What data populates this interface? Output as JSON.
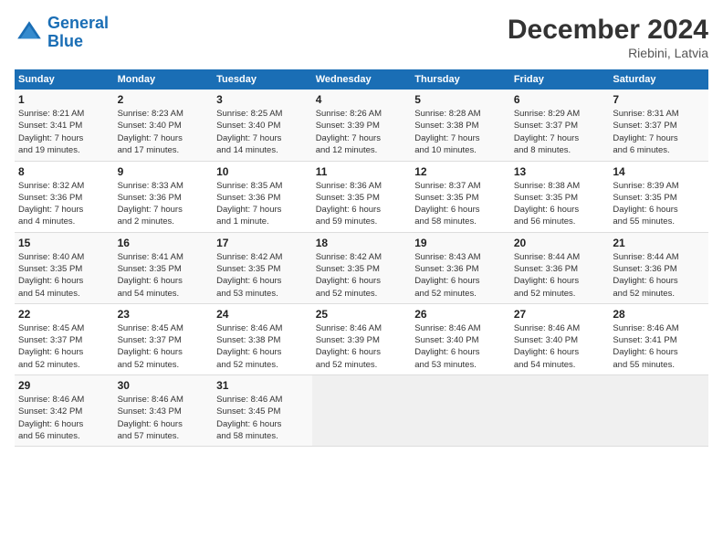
{
  "header": {
    "logo_line1": "General",
    "logo_line2": "Blue",
    "month": "December 2024",
    "location": "Riebini, Latvia"
  },
  "days_of_week": [
    "Sunday",
    "Monday",
    "Tuesday",
    "Wednesday",
    "Thursday",
    "Friday",
    "Saturday"
  ],
  "weeks": [
    [
      {
        "day": "1",
        "info": "Sunrise: 8:21 AM\nSunset: 3:41 PM\nDaylight: 7 hours\nand 19 minutes."
      },
      {
        "day": "2",
        "info": "Sunrise: 8:23 AM\nSunset: 3:40 PM\nDaylight: 7 hours\nand 17 minutes."
      },
      {
        "day": "3",
        "info": "Sunrise: 8:25 AM\nSunset: 3:40 PM\nDaylight: 7 hours\nand 14 minutes."
      },
      {
        "day": "4",
        "info": "Sunrise: 8:26 AM\nSunset: 3:39 PM\nDaylight: 7 hours\nand 12 minutes."
      },
      {
        "day": "5",
        "info": "Sunrise: 8:28 AM\nSunset: 3:38 PM\nDaylight: 7 hours\nand 10 minutes."
      },
      {
        "day": "6",
        "info": "Sunrise: 8:29 AM\nSunset: 3:37 PM\nDaylight: 7 hours\nand 8 minutes."
      },
      {
        "day": "7",
        "info": "Sunrise: 8:31 AM\nSunset: 3:37 PM\nDaylight: 7 hours\nand 6 minutes."
      }
    ],
    [
      {
        "day": "8",
        "info": "Sunrise: 8:32 AM\nSunset: 3:36 PM\nDaylight: 7 hours\nand 4 minutes."
      },
      {
        "day": "9",
        "info": "Sunrise: 8:33 AM\nSunset: 3:36 PM\nDaylight: 7 hours\nand 2 minutes."
      },
      {
        "day": "10",
        "info": "Sunrise: 8:35 AM\nSunset: 3:36 PM\nDaylight: 7 hours\nand 1 minute."
      },
      {
        "day": "11",
        "info": "Sunrise: 8:36 AM\nSunset: 3:35 PM\nDaylight: 6 hours\nand 59 minutes."
      },
      {
        "day": "12",
        "info": "Sunrise: 8:37 AM\nSunset: 3:35 PM\nDaylight: 6 hours\nand 58 minutes."
      },
      {
        "day": "13",
        "info": "Sunrise: 8:38 AM\nSunset: 3:35 PM\nDaylight: 6 hours\nand 56 minutes."
      },
      {
        "day": "14",
        "info": "Sunrise: 8:39 AM\nSunset: 3:35 PM\nDaylight: 6 hours\nand 55 minutes."
      }
    ],
    [
      {
        "day": "15",
        "info": "Sunrise: 8:40 AM\nSunset: 3:35 PM\nDaylight: 6 hours\nand 54 minutes."
      },
      {
        "day": "16",
        "info": "Sunrise: 8:41 AM\nSunset: 3:35 PM\nDaylight: 6 hours\nand 54 minutes."
      },
      {
        "day": "17",
        "info": "Sunrise: 8:42 AM\nSunset: 3:35 PM\nDaylight: 6 hours\nand 53 minutes."
      },
      {
        "day": "18",
        "info": "Sunrise: 8:42 AM\nSunset: 3:35 PM\nDaylight: 6 hours\nand 52 minutes."
      },
      {
        "day": "19",
        "info": "Sunrise: 8:43 AM\nSunset: 3:36 PM\nDaylight: 6 hours\nand 52 minutes."
      },
      {
        "day": "20",
        "info": "Sunrise: 8:44 AM\nSunset: 3:36 PM\nDaylight: 6 hours\nand 52 minutes."
      },
      {
        "day": "21",
        "info": "Sunrise: 8:44 AM\nSunset: 3:36 PM\nDaylight: 6 hours\nand 52 minutes."
      }
    ],
    [
      {
        "day": "22",
        "info": "Sunrise: 8:45 AM\nSunset: 3:37 PM\nDaylight: 6 hours\nand 52 minutes."
      },
      {
        "day": "23",
        "info": "Sunrise: 8:45 AM\nSunset: 3:37 PM\nDaylight: 6 hours\nand 52 minutes."
      },
      {
        "day": "24",
        "info": "Sunrise: 8:46 AM\nSunset: 3:38 PM\nDaylight: 6 hours\nand 52 minutes."
      },
      {
        "day": "25",
        "info": "Sunrise: 8:46 AM\nSunset: 3:39 PM\nDaylight: 6 hours\nand 52 minutes."
      },
      {
        "day": "26",
        "info": "Sunrise: 8:46 AM\nSunset: 3:40 PM\nDaylight: 6 hours\nand 53 minutes."
      },
      {
        "day": "27",
        "info": "Sunrise: 8:46 AM\nSunset: 3:40 PM\nDaylight: 6 hours\nand 54 minutes."
      },
      {
        "day": "28",
        "info": "Sunrise: 8:46 AM\nSunset: 3:41 PM\nDaylight: 6 hours\nand 55 minutes."
      }
    ],
    [
      {
        "day": "29",
        "info": "Sunrise: 8:46 AM\nSunset: 3:42 PM\nDaylight: 6 hours\nand 56 minutes."
      },
      {
        "day": "30",
        "info": "Sunrise: 8:46 AM\nSunset: 3:43 PM\nDaylight: 6 hours\nand 57 minutes."
      },
      {
        "day": "31",
        "info": "Sunrise: 8:46 AM\nSunset: 3:45 PM\nDaylight: 6 hours\nand 58 minutes."
      },
      null,
      null,
      null,
      null
    ]
  ]
}
